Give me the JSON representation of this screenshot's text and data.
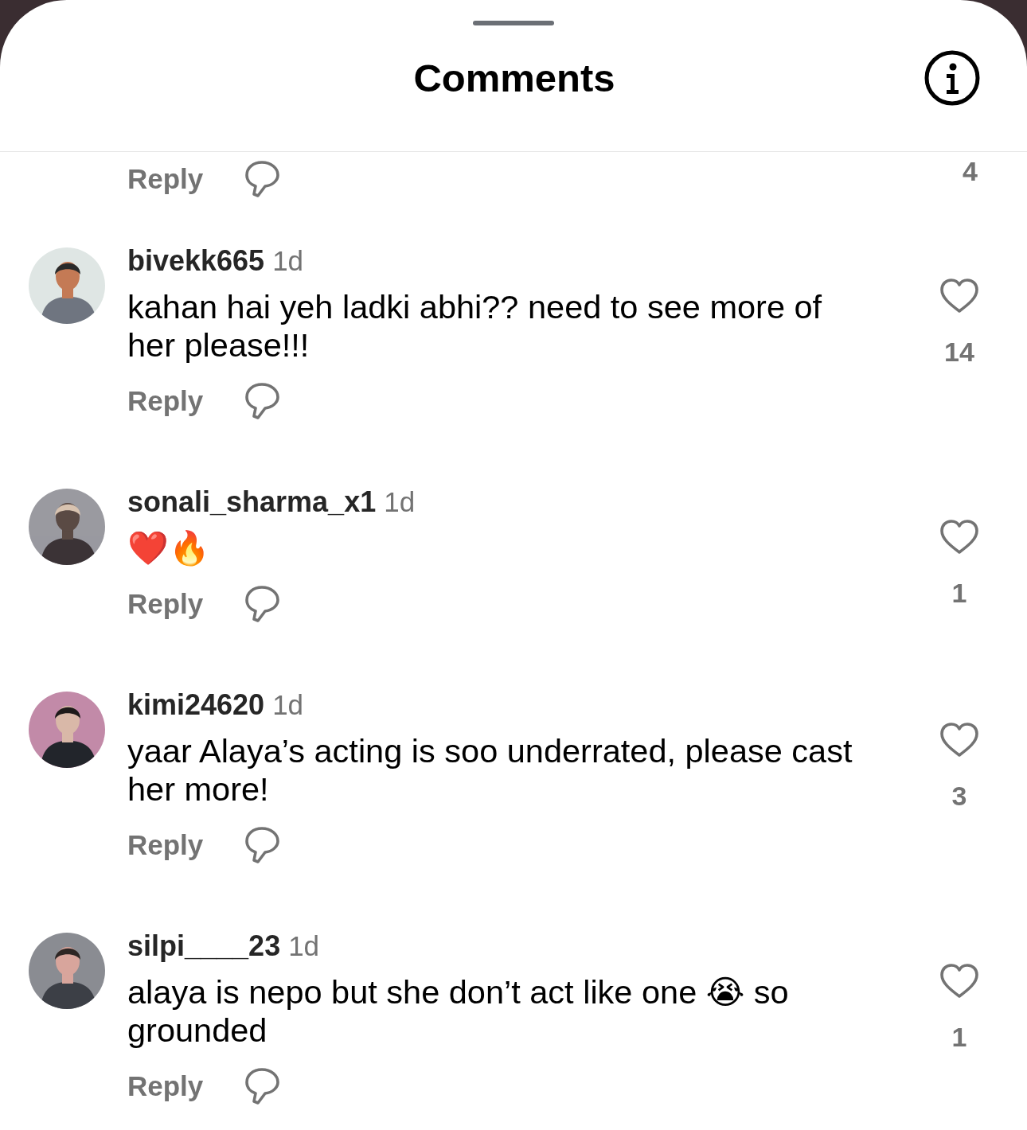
{
  "sheet": {
    "title": "Comments"
  },
  "partial_comment": {
    "reply": "Reply",
    "likes": "4"
  },
  "comments": [
    {
      "username": "bivekk665",
      "time": "1d",
      "text": "kahan hai yeh ladki abhi?? need to see more of her please!!!",
      "reply": "Reply",
      "likes": "14",
      "liked": false
    },
    {
      "username": "sonali_sharma_x1",
      "time": "1d",
      "text": "❤️🔥",
      "reply": "Reply",
      "likes": "1",
      "liked": false
    },
    {
      "username": "kimi24620",
      "time": "1d",
      "text": "yaar Alaya’s acting is soo underrated, please cast her more!",
      "reply": "Reply",
      "likes": "3",
      "liked": false
    },
    {
      "username": "silpi____23",
      "time": "1d",
      "text": "alaya is nepo but she don’t act like one 😭 so grounded",
      "reply": "Reply",
      "likes": "1",
      "liked": false
    }
  ]
}
